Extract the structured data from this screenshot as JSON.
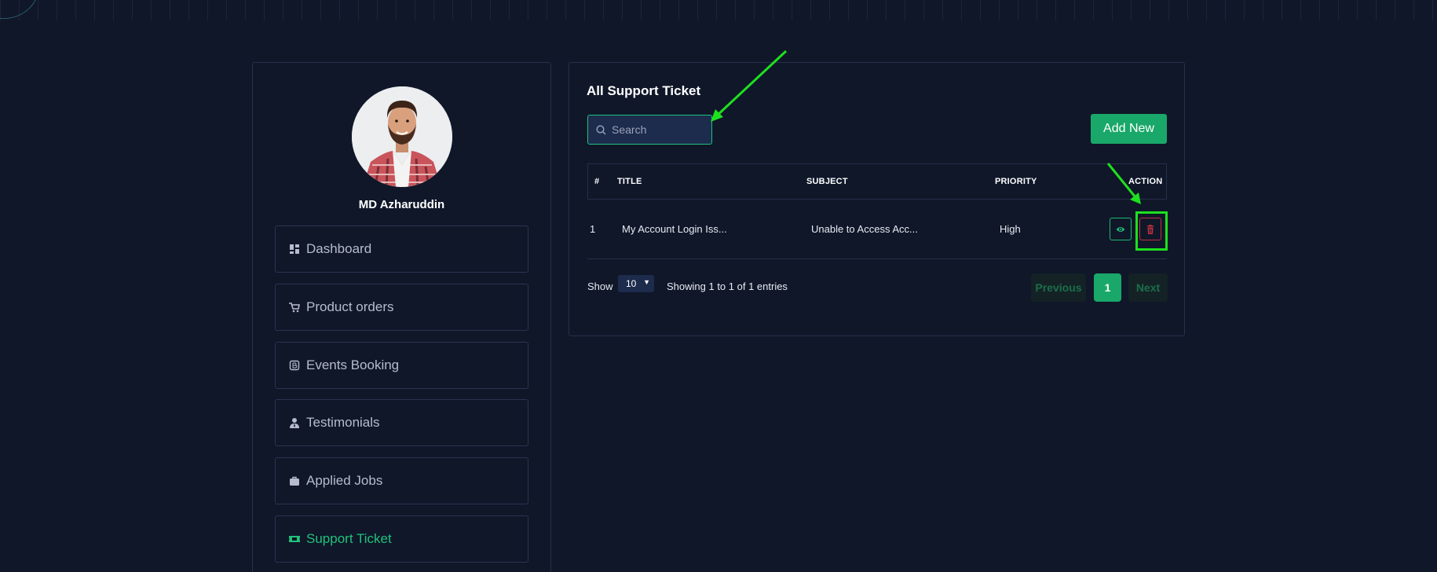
{
  "user": {
    "name": "MD Azharuddin"
  },
  "sidebar": {
    "items": [
      {
        "label": "Dashboard",
        "icon": "dashboard-icon"
      },
      {
        "label": "Product orders",
        "icon": "cart-icon"
      },
      {
        "label": "Events Booking",
        "icon": "booking-icon"
      },
      {
        "label": "Testimonials",
        "icon": "user-tie-icon"
      },
      {
        "label": "Applied Jobs",
        "icon": "briefcase-icon"
      },
      {
        "label": "Support Ticket",
        "icon": "ticket-icon",
        "active": true
      }
    ]
  },
  "main": {
    "title": "All Support Ticket",
    "search": {
      "placeholder": "Search",
      "value": ""
    },
    "add_button": "Add New",
    "table": {
      "headers": [
        "#",
        "TITLE",
        "SUBJECT",
        "PRIORITY",
        "ACTION"
      ],
      "rows": [
        {
          "num": "1",
          "title": "My Account Login Iss...",
          "subject": "Unable to Access Acc...",
          "priority": "High"
        }
      ]
    },
    "footer": {
      "show_label": "Show",
      "page_size": "10",
      "entries_info": "Showing 1 to 1 of 1 entries"
    },
    "pagination": {
      "previous": "Previous",
      "current": "1",
      "next": "Next"
    }
  },
  "colors": {
    "background": "#0f1729",
    "accent": "#19a869",
    "danger": "#c0303f",
    "annotation": "#1ee01e"
  }
}
